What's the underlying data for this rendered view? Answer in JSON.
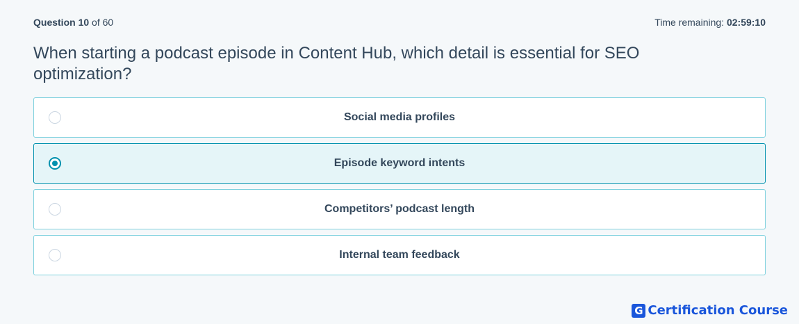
{
  "header": {
    "question_label": "Question",
    "question_number": "10",
    "of_text": "of 60",
    "time_label": "Time remaining:",
    "time_value": "02:59:10"
  },
  "question": {
    "text": "When starting a podcast episode in Content Hub, which detail is essential for SEO optimization?"
  },
  "options": [
    {
      "label": "Social media profiles",
      "selected": false
    },
    {
      "label": "Episode keyword intents",
      "selected": true
    },
    {
      "label": "Competitors’ podcast length",
      "selected": false
    },
    {
      "label": "Internal team feedback",
      "selected": false
    }
  ],
  "brand": {
    "icon_letter": "G",
    "name": "Certification Course",
    "color": "#1a56db"
  },
  "colors": {
    "accent": "#0091ae",
    "option_border": "#7fd1de",
    "selected_bg": "#e5f5f8",
    "text": "#33475b"
  }
}
